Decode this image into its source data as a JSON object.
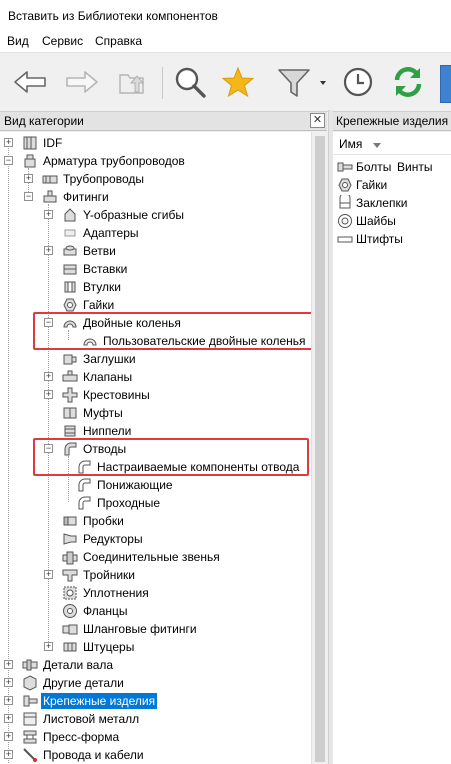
{
  "window": {
    "title": "Вставить из Библиотеки компонентов"
  },
  "menu": [
    "Вид",
    "Сервис",
    "Справка"
  ],
  "toolbar": {
    "buttons": [
      "back-arrow-icon",
      "forward-arrow-icon",
      "up-folder-icon",
      "search-icon",
      "favorites-star-icon",
      "filter-icon",
      "history-clock-icon",
      "refresh-icon"
    ],
    "colors": {
      "star": "#f3b71a",
      "refresh": "#2fa043",
      "filter": "#7a7a7a"
    }
  },
  "left_panel": {
    "header": "Вид категории",
    "close_label": "✕",
    "tree": [
      {
        "label": "IDF"
      },
      {
        "label": "Арматура трубопроводов"
      },
      {
        "label": "Трубопроводы"
      },
      {
        "label": "Фитинги"
      },
      {
        "label": "Y-образные сгибы"
      },
      {
        "label": "Адаптеры"
      },
      {
        "label": "Ветви"
      },
      {
        "label": "Вставки"
      },
      {
        "label": "Втулки"
      },
      {
        "label": "Гайки"
      },
      {
        "label": "Двойные коленья"
      },
      {
        "label": "Пользовательские двойные коленья"
      },
      {
        "label": "Заглушки"
      },
      {
        "label": "Клапаны"
      },
      {
        "label": "Крестовины"
      },
      {
        "label": "Муфты"
      },
      {
        "label": "Ниппели"
      },
      {
        "label": "Отводы"
      },
      {
        "label": "Настраиваемые компоненты отвода"
      },
      {
        "label": "Понижающие"
      },
      {
        "label": "Проходные"
      },
      {
        "label": "Пробки"
      },
      {
        "label": "Редукторы"
      },
      {
        "label": "Соединительные звенья"
      },
      {
        "label": "Тройники"
      },
      {
        "label": "Уплотнения"
      },
      {
        "label": "Фланцы"
      },
      {
        "label": "Шланговые фитинги"
      },
      {
        "label": "Штуцеры"
      },
      {
        "label": "Детали вала"
      },
      {
        "label": "Другие детали"
      },
      {
        "label": "Крепежные изделия"
      },
      {
        "label": "Листовой металл"
      },
      {
        "label": "Пресс-форма"
      },
      {
        "label": "Провода и кабели"
      }
    ],
    "expander_plus": "+",
    "expander_minus": "−"
  },
  "right_panel": {
    "header": "Крепежные изделия",
    "column": "Имя",
    "items": [
      "Болты",
      "Винты",
      "Гайки",
      "Заклепки",
      "Шайбы",
      "Штифты"
    ]
  }
}
